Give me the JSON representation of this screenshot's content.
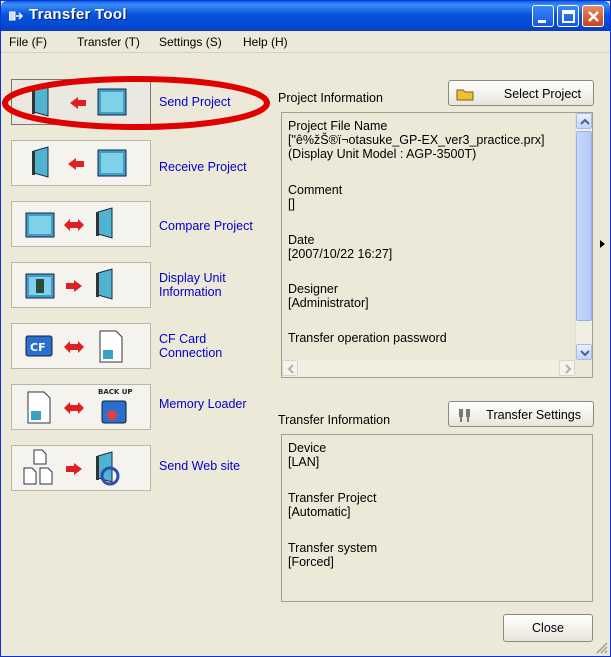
{
  "window": {
    "title": "Transfer Tool"
  },
  "menu": [
    "File (F)",
    "Transfer (T)",
    "Settings (S)",
    "Help (H)"
  ],
  "tools": [
    {
      "label": "Send Project"
    },
    {
      "label": "Receive Project"
    },
    {
      "label": "Compare Project"
    },
    {
      "label1": "Display Unit",
      "label2": "Information"
    },
    {
      "label1": "CF Card",
      "label2": "Connection"
    },
    {
      "label": "Memory Loader",
      "icon_text": "BACK UP"
    },
    {
      "label": "Send Web site"
    }
  ],
  "project": {
    "heading": "Project Information",
    "select_button": "Select Project",
    "lines": [
      "Project File Name",
      "[\"ê%žŠ®ï¬otasuke_GP-EX_ver3_practice.prx]",
      "(Display Unit Model : AGP-3500T)",
      "",
      "Comment",
      "[]",
      "",
      "Date",
      "[2007/10/22 16:27]",
      "",
      "Designer",
      "[Administrator]",
      "",
      "Transfer operation password"
    ]
  },
  "transfer": {
    "heading": "Transfer Information",
    "settings_button": "Transfer Settings",
    "lines": [
      "Device",
      "[LAN]",
      "",
      "Transfer Project",
      "[Automatic]",
      "",
      "Transfer system",
      "[Forced]"
    ]
  },
  "footer": {
    "close_button": "Close"
  },
  "colors": {
    "title_bar": "#0855dd",
    "link_text": "#0000cc",
    "highlight": "#e00000"
  }
}
